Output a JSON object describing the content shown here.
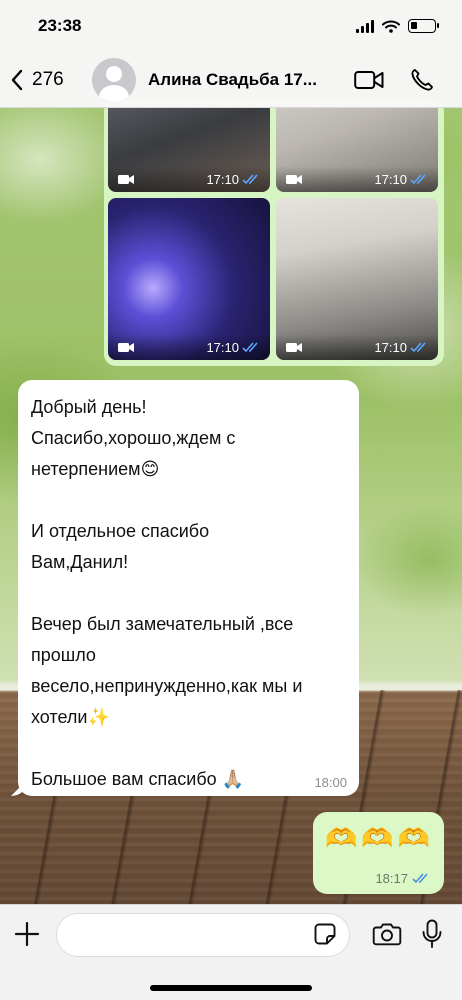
{
  "status_bar": {
    "time": "23:38"
  },
  "header": {
    "back_count": "276",
    "title": "Алина Свадьба 17...",
    "icons": {
      "back": "chevron-left-icon",
      "video": "video-camera-icon",
      "call": "phone-icon"
    }
  },
  "media": {
    "tiles": [
      {
        "time": "17:10",
        "kind": "video"
      },
      {
        "time": "17:10",
        "kind": "video"
      },
      {
        "time": "17:10",
        "kind": "video"
      },
      {
        "time": "17:10",
        "kind": "video"
      }
    ]
  },
  "incoming_message": {
    "lines": [
      "Добрый день!",
      "Спасибо,хорошо,ждем с",
      "нетерпением",
      "",
      "И отдельное спасибо",
      "Вам,Данил!",
      "",
      "Вечер был замечательный ,все",
      "прошло",
      "весело,непринужденно,как мы и",
      "хотели",
      "",
      "Большое вам спасибо"
    ],
    "emojis": {
      "line_2": "😊",
      "line_10": "✨",
      "line_12": "🙏🏼"
    },
    "time": "18:00"
  },
  "outgoing_message": {
    "emojis": [
      "🫶",
      "🫶",
      "🫶"
    ],
    "time": "18:17"
  },
  "composer": {
    "value": "",
    "placeholder": ""
  },
  "colors": {
    "incoming_bubble": "#ffffff",
    "outgoing_bubble": "#dcf8c6",
    "read_ticks": "#4a90e2"
  }
}
